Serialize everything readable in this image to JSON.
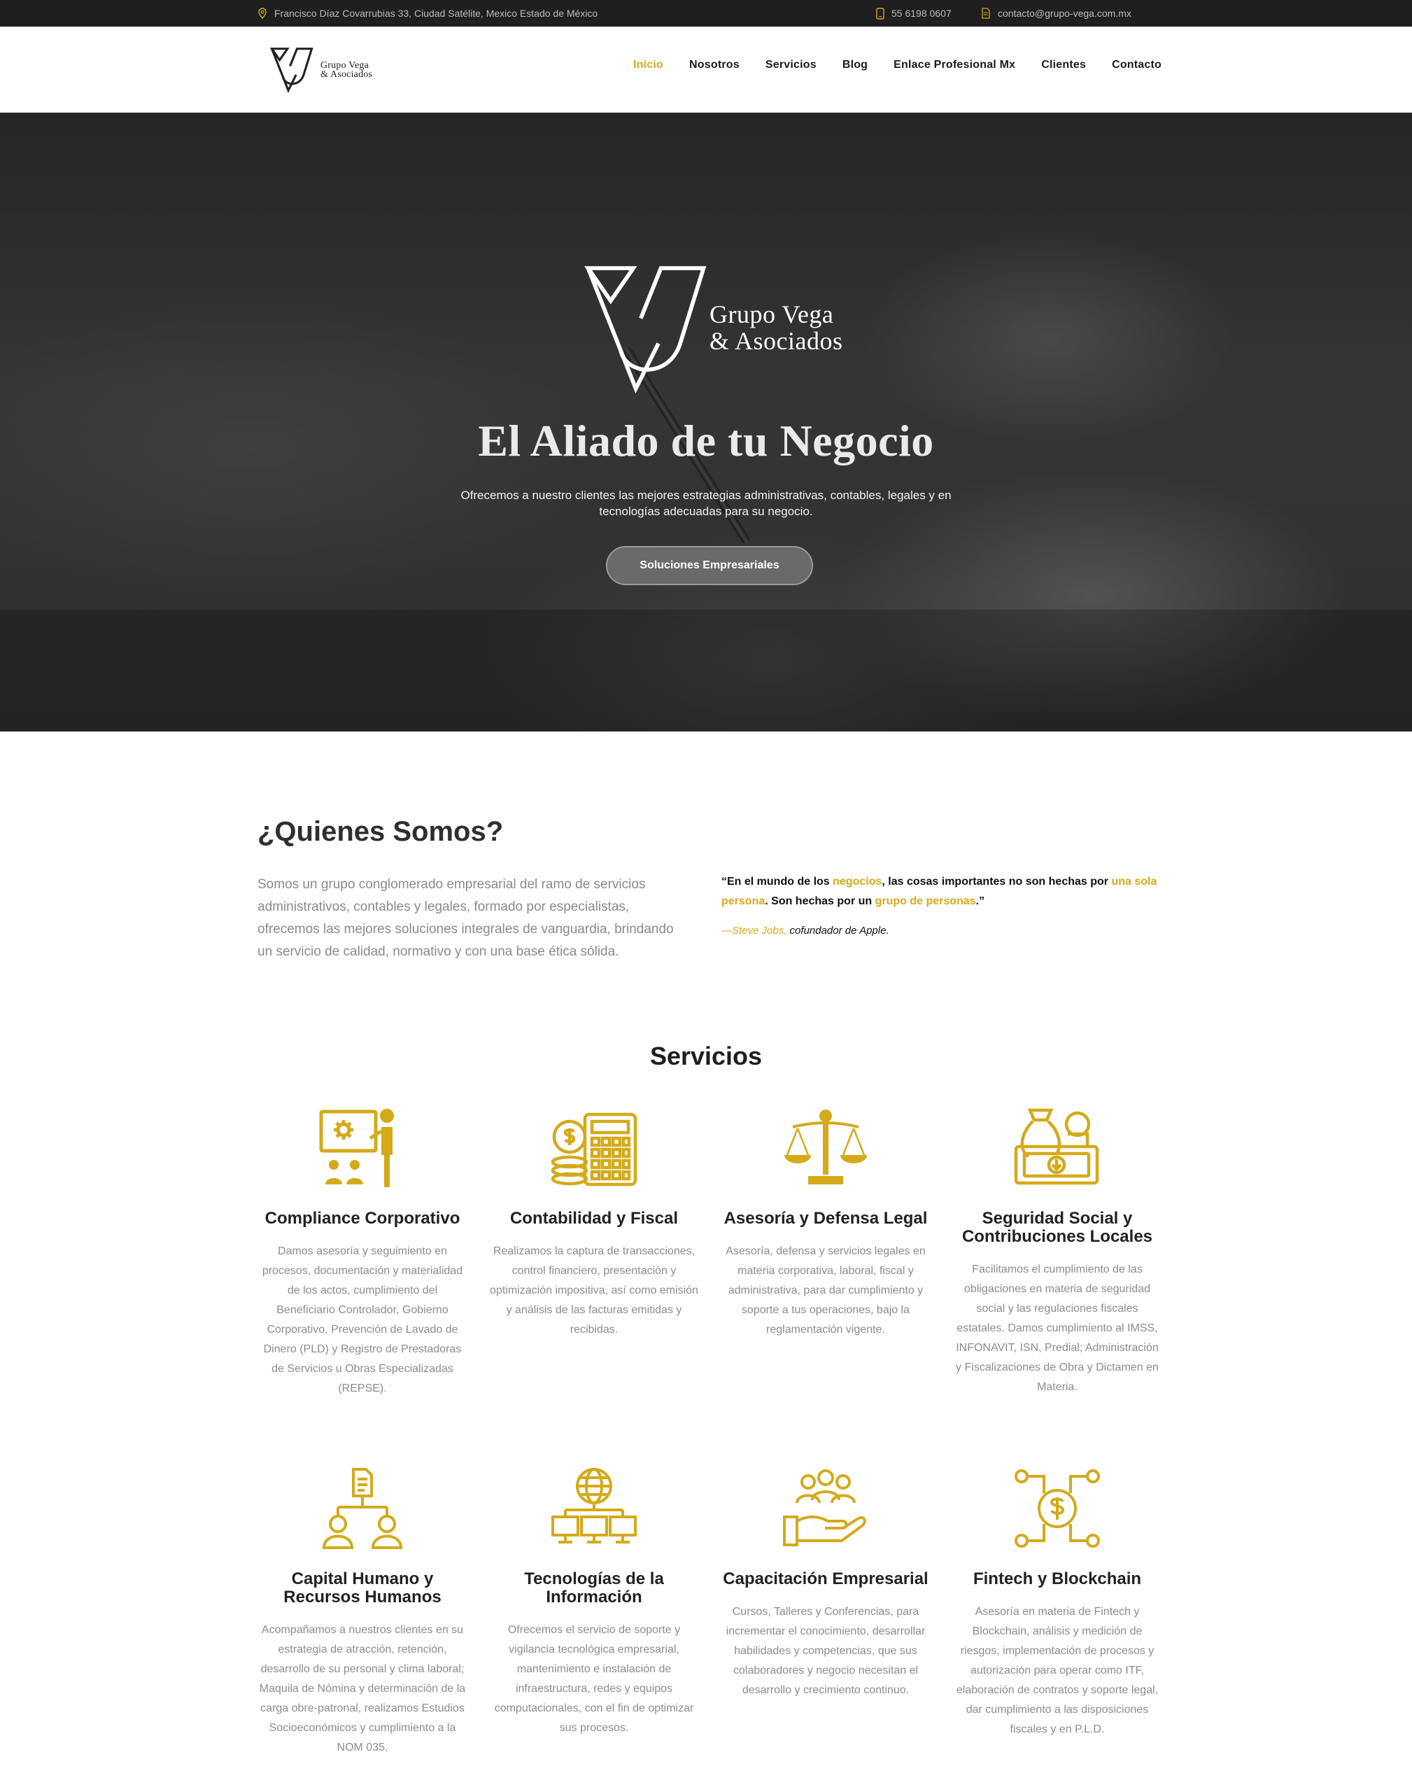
{
  "topbar": {
    "address": "Francisco Díaz Covarrubias 33, Ciudad Satélite, Mexico Estado de México",
    "phone": "55 6198 0607",
    "email": "contacto@grupo-vega.com.mx"
  },
  "brand": {
    "name_line1": "Grupo Vega",
    "name_line2": "& Asociados",
    "accent_color": "#d4aa1a"
  },
  "nav": {
    "items": [
      "Inicio",
      "Nosotros",
      "Servicios",
      "Blog",
      "Enlace Profesional Mx",
      "Clientes",
      "Contacto"
    ],
    "active": "Inicio"
  },
  "hero": {
    "title": "El Aliado de tu Negocio",
    "subtitle": "Ofrecemos a nuestro clientes las mejores estrategias administrativas, contables, legales y en tecnologías adecuadas para su negocio.",
    "cta": "Soluciones Empresariales"
  },
  "about": {
    "title": "¿Quienes Somos?",
    "text": "Somos un grupo conglomerado empresarial del ramo de servicios administrativos, contables y legales, formado por especialistas, ofrecemos las mejores soluciones integrales de vanguardia, brindando un servicio de calidad, normativo y con una base ética sólida.",
    "quote": {
      "p1": "“En el mundo de los ",
      "h1": "negocios",
      "p2": ", las cosas importantes no son hechas por ",
      "h2": "una sola persona",
      "p3": ". Son hechas por un ",
      "h3": "grupo de personas",
      "p4": ".”"
    },
    "cite": {
      "name": "—Steve Jobs,",
      "role": " cofundador de Apple."
    }
  },
  "services": {
    "title": "Servicios",
    "items": [
      {
        "icon": "presentation-icon",
        "title": "Compliance Corporativo",
        "desc": "Damos asesoría y seguimiento en procesos, documentación y materialidad de los actos, cumplimiento del Beneficiario Controlador, Gobierno Corporativo, Prevención de Lavado de Dinero (PLD) y Registro de Prestadoras de Servicios u Obras Especializadas (REPSE)."
      },
      {
        "icon": "calculator-coins-icon",
        "title": "Contabilidad y Fiscal",
        "desc": "Realizamos la captura de transacciones, control financiero, presentación y optimización impositiva, así como emisión y análisis de las facturas emitidas y recibidas."
      },
      {
        "icon": "scales-icon",
        "title": "Asesoría y Defensa Legal",
        "desc": "Asesoría, defensa y servicios legales en materia corporativa, laboral, fiscal y administrativa, para dar cumplimiento y soporte a tus operaciones, bajo la reglamentación vigente."
      },
      {
        "icon": "money-bag-icon",
        "title": "Seguridad Social y Contribuciones Locales",
        "desc": "Facilitamos el cumplimiento de las obligaciones en materia de seguridad social y las regulaciones fiscales estatales. Damos cumplimiento al IMSS, INFONAVIT, ISN, Predial; Administración y Fiscalizaciones de Obra y Dictamen en Materia."
      },
      {
        "icon": "org-chart-icon",
        "title": "Capital Humano y Recursos Humanos",
        "desc": "Acompañamos a nuestros clientes en su estrategia de atracción, retención, desarrollo de su personal y clima laboral; Maquila de Nómina y determinación de la carga obre-patronal, realizamos Estudios Socioeconómicos y cumplimiento a la NOM 035."
      },
      {
        "icon": "network-globe-icon",
        "title": "Tecnologías de la Información",
        "desc": "Ofrecemos el servicio de soporte y vigilancia tecnológica empresarial, mantenimiento e instalación de infraestructura, redes y equipos computacionales, con el fin de optimizar sus procesos."
      },
      {
        "icon": "hand-people-icon",
        "title": "Capacitación Empresarial",
        "desc": "Cursos, Talleres y Conferencias, para incrementar el conocimiento, desarrollar habilidades y competencias, que sus colaboradores y negocio necesitan el desarrollo y crecimiento continuo."
      },
      {
        "icon": "fintech-coin-icon",
        "title": "Fintech y Blockchain",
        "desc": "Asesoría en materia de Fintech y Blockchain, análisis y medición de riesgos, implementación de procesos y autorización para operar como ITF, elaboración de contratos y soporte legal, dar cumplimiento a las disposiciones fiscales y en P.L.D."
      }
    ]
  }
}
